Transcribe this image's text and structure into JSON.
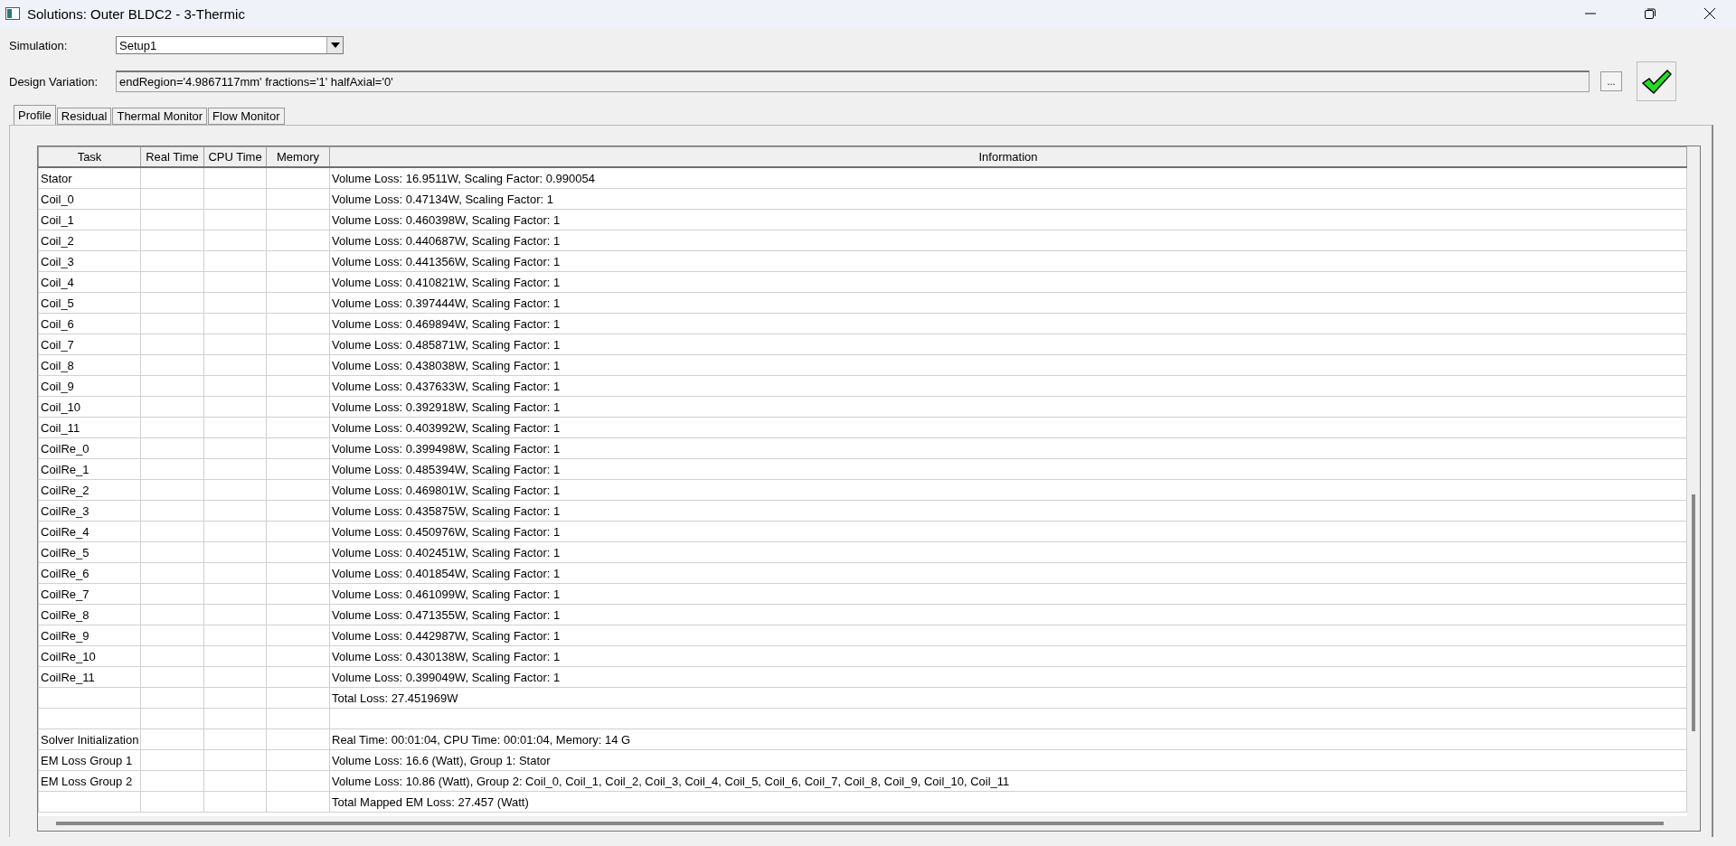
{
  "window": {
    "title": "Solutions: Outer BLDC2 - 3-Thermic"
  },
  "simulation": {
    "label": "Simulation:",
    "value": "Setup1"
  },
  "design_variation": {
    "label": "Design Variation:",
    "value": "endRegion='4.9867117mm' fractions='1' halfAxial='0'",
    "browse_button": "..."
  },
  "tabs": [
    {
      "label": "Profile",
      "selected": true
    },
    {
      "label": "Residual",
      "selected": false
    },
    {
      "label": "Thermal Monitor",
      "selected": false
    },
    {
      "label": "Flow Monitor",
      "selected": false
    }
  ],
  "table": {
    "columns": [
      "Task",
      "Real Time",
      "CPU Time",
      "Memory",
      "Information"
    ],
    "rows": [
      {
        "task": "Stator",
        "information": "Volume Loss: 16.9511W, Scaling Factor: 0.990054"
      },
      {
        "task": "Coil_0",
        "information": "Volume Loss: 0.47134W, Scaling Factor: 1"
      },
      {
        "task": "Coil_1",
        "information": "Volume Loss: 0.460398W, Scaling Factor: 1"
      },
      {
        "task": "Coil_2",
        "information": "Volume Loss: 0.440687W, Scaling Factor: 1"
      },
      {
        "task": "Coil_3",
        "information": "Volume Loss: 0.441356W, Scaling Factor: 1"
      },
      {
        "task": "Coil_4",
        "information": "Volume Loss: 0.410821W, Scaling Factor: 1"
      },
      {
        "task": "Coil_5",
        "information": "Volume Loss: 0.397444W, Scaling Factor: 1"
      },
      {
        "task": "Coil_6",
        "information": "Volume Loss: 0.469894W, Scaling Factor: 1"
      },
      {
        "task": "Coil_7",
        "information": "Volume Loss: 0.485871W, Scaling Factor: 1"
      },
      {
        "task": "Coil_8",
        "information": "Volume Loss: 0.438038W, Scaling Factor: 1"
      },
      {
        "task": "Coil_9",
        "information": "Volume Loss: 0.437633W, Scaling Factor: 1"
      },
      {
        "task": "Coil_10",
        "information": "Volume Loss: 0.392918W, Scaling Factor: 1"
      },
      {
        "task": "Coil_11",
        "information": "Volume Loss: 0.403992W, Scaling Factor: 1"
      },
      {
        "task": "CoilRe_0",
        "information": "Volume Loss: 0.399498W, Scaling Factor: 1"
      },
      {
        "task": "CoilRe_1",
        "information": "Volume Loss: 0.485394W, Scaling Factor: 1"
      },
      {
        "task": "CoilRe_2",
        "information": "Volume Loss: 0.469801W, Scaling Factor: 1"
      },
      {
        "task": "CoilRe_3",
        "information": "Volume Loss: 0.435875W, Scaling Factor: 1"
      },
      {
        "task": "CoilRe_4",
        "information": "Volume Loss: 0.450976W, Scaling Factor: 1"
      },
      {
        "task": "CoilRe_5",
        "information": "Volume Loss: 0.402451W, Scaling Factor: 1"
      },
      {
        "task": "CoilRe_6",
        "information": "Volume Loss: 0.401854W, Scaling Factor: 1"
      },
      {
        "task": "CoilRe_7",
        "information": "Volume Loss: 0.461099W, Scaling Factor: 1"
      },
      {
        "task": "CoilRe_8",
        "information": "Volume Loss: 0.471355W, Scaling Factor: 1"
      },
      {
        "task": "CoilRe_9",
        "information": "Volume Loss: 0.442987W, Scaling Factor: 1"
      },
      {
        "task": "CoilRe_10",
        "information": "Volume Loss: 0.430138W, Scaling Factor: 1"
      },
      {
        "task": "CoilRe_11",
        "information": "Volume Loss: 0.399049W, Scaling Factor: 1"
      },
      {
        "information": "Total Loss: 27.451969W"
      },
      {},
      {
        "task": "Solver Initialization",
        "information": "Real Time: 00:01:04, CPU Time: 00:01:04, Memory: 14 G"
      },
      {
        "task": "EM Loss Group 1",
        "information": "Volume Loss: 16.6 (Watt), Group 1: Stator"
      },
      {
        "task": "EM Loss Group 2",
        "information": "Volume Loss: 10.86 (Watt), Group 2: Coil_0, Coil_1, Coil_2, Coil_3, Coil_4, Coil_5, Coil_6, Coil_7, Coil_8, Coil_9, Coil_10, Coil_11"
      },
      {
        "information": "Total Mapped EM Loss: 27.457 (Watt)"
      }
    ]
  }
}
